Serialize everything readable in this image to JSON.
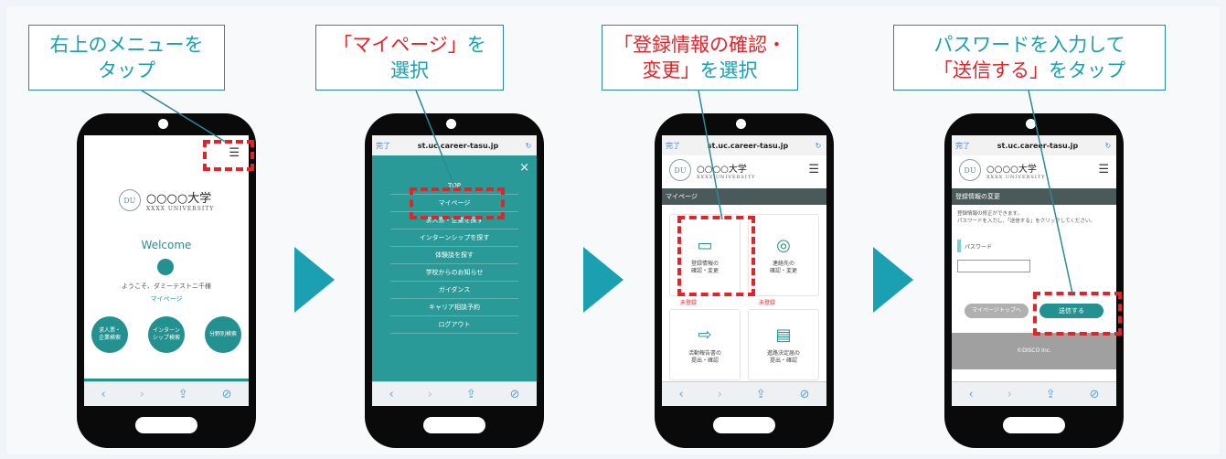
{
  "callouts": [
    {
      "line1_a": "右上のメニューを",
      "line1_r": "",
      "line1_b": "",
      "line2_a": "タップ",
      "line2_r": "",
      "line2_b": ""
    },
    {
      "line1_a": "",
      "line1_r": "「マイページ」",
      "line1_b": "を",
      "line2_a": "選択",
      "line2_r": "",
      "line2_b": ""
    },
    {
      "line1_a": "",
      "line1_r": "「登録情報の確認・",
      "line1_b": "",
      "line2_a": "",
      "line2_r": "変更」",
      "line2_b": "を選択"
    },
    {
      "line1_a": "パスワードを入力して",
      "line1_r": "",
      "line1_b": "",
      "line2_a": "",
      "line2_r": "「送信する」",
      "line2_b": "をタップ"
    }
  ],
  "phone1": {
    "logo_seal": "DU",
    "logo_name": "○○○○大学",
    "logo_sub": "XXXX UNIVERSITY",
    "welcome": "Welcome",
    "greeting": "ようこそ、ダミーテストニ千様",
    "mypage_link": "マイページ",
    "circle_buttons": [
      "求人票・\n企業検索",
      "インターン\nシップ検索",
      "分野別検索"
    ],
    "menu_icon": "hamburger-icon"
  },
  "phone2": {
    "done": "完了",
    "url": "st.uc.career-tasu.jp",
    "close": "×",
    "menu": [
      "TOP",
      "マイページ",
      "求人票・企業を探す",
      "インターンシップを探す",
      "体験談を探す",
      "学校からのお知らせ",
      "ガイダンス",
      "キャリア相談予約",
      "ログアウト"
    ]
  },
  "phone3": {
    "done": "完了",
    "url": "st.uc.career-tasu.jp",
    "logo_seal": "DU",
    "logo_name": "○○○○大学",
    "logo_sub": "XXXX UNIVERSITY",
    "banner": "マイページ",
    "tiles": [
      "登録情報の\n確認・変更",
      "連絡先の\n確認・変更",
      "活動報告書の\n提出・確認",
      "進路決定届の\n提出・確認"
    ],
    "badge": "未登録"
  },
  "phone4": {
    "done": "完了",
    "url": "st.uc.career-tasu.jp",
    "logo_seal": "DU",
    "logo_name": "○○○○大学",
    "logo_sub": "XXXX UNIVERSITY",
    "banner": "登録情報の変更",
    "desc": "登録情報の修正ができます。\nパスワードを入力し、「送信する」をクリックしてください。",
    "password_label": "パスワード",
    "back_button": "マイページトップへ",
    "submit_button": "送信する",
    "footer": "©DISCO Inc."
  },
  "colors": {
    "accent": "#1aa0b0",
    "red": "#e0242a",
    "teal_dark": "#23918f"
  }
}
